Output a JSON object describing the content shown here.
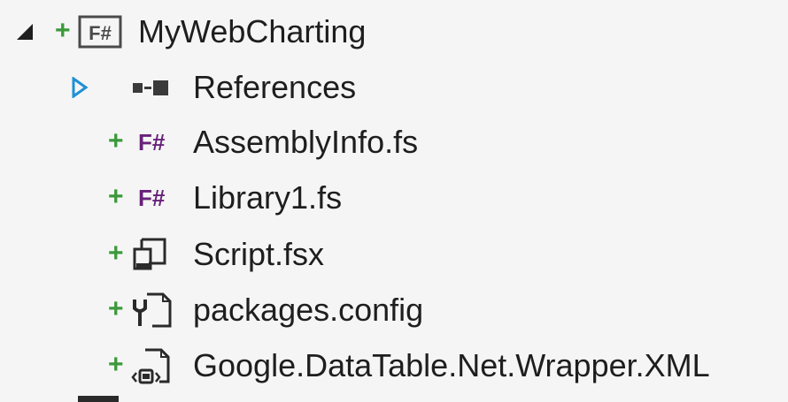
{
  "tree": {
    "project": {
      "label": "MyWebCharting",
      "icon": "fsharp-project-icon",
      "expanded": true
    },
    "items": [
      {
        "label": "References",
        "icon": "references-icon",
        "expanded": false
      },
      {
        "label": "AssemblyInfo.fs",
        "icon": "fsharp-file-icon"
      },
      {
        "label": "Library1.fs",
        "icon": "fsharp-file-icon"
      },
      {
        "label": "Script.fsx",
        "icon": "fsharp-script-icon"
      },
      {
        "label": "packages.config",
        "icon": "config-file-icon"
      },
      {
        "label": "Google.DataTable.Net.Wrapper.XML",
        "icon": "xml-file-icon"
      }
    ],
    "icons": {
      "fsharp_project_text": "F#",
      "fsharp_file_text": "F#"
    }
  },
  "colors": {
    "background": "#f5f5f5",
    "text": "#1e1e1e",
    "added_plus": "#3a9a3a",
    "fsharp_purple": "#68217a",
    "expander_blue": "#1e90d6"
  }
}
